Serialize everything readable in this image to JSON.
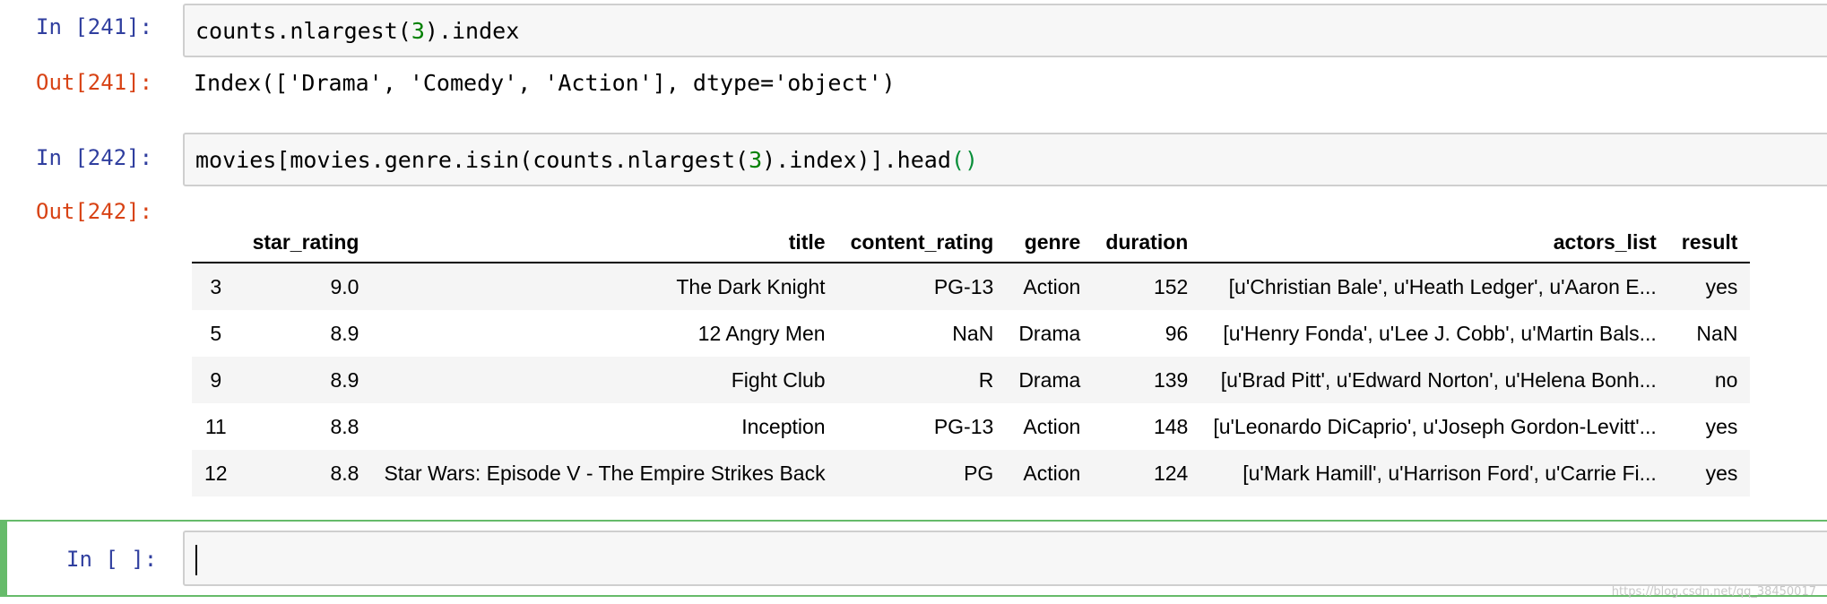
{
  "cells": [
    {
      "in_prompt": "In [241]:",
      "code": {
        "pre": "counts.nlargest(",
        "num": "3",
        "post": ").index"
      },
      "out_prompt": "Out[241]:",
      "output": "Index(['Drama', 'Comedy', 'Action'], dtype='object')"
    },
    {
      "in_prompt": "In [242]:",
      "code": {
        "pre": "movies[movies.genre.isin(counts.nlargest(",
        "num": "3",
        "mid": ").index)].head",
        "parens": "()"
      },
      "out_prompt": "Out[242]:",
      "table": {
        "columns": [
          "",
          "star_rating",
          "title",
          "content_rating",
          "genre",
          "duration",
          "actors_list",
          "result"
        ],
        "rows": [
          [
            "3",
            "9.0",
            "The Dark Knight",
            "PG-13",
            "Action",
            "152",
            "[u'Christian Bale', u'Heath Ledger', u'Aaron E...",
            "yes"
          ],
          [
            "5",
            "8.9",
            "12 Angry Men",
            "NaN",
            "Drama",
            "96",
            "[u'Henry Fonda', u'Lee J. Cobb', u'Martin Bals...",
            "NaN"
          ],
          [
            "9",
            "8.9",
            "Fight Club",
            "R",
            "Drama",
            "139",
            "[u'Brad Pitt', u'Edward Norton', u'Helena Bonh...",
            "no"
          ],
          [
            "11",
            "8.8",
            "Inception",
            "PG-13",
            "Action",
            "148",
            "[u'Leonardo DiCaprio', u'Joseph Gordon-Levitt'...",
            "yes"
          ],
          [
            "12",
            "8.8",
            "Star Wars: Episode V - The Empire Strikes Back",
            "PG",
            "Action",
            "124",
            "[u'Mark Hamill', u'Harrison Ford', u'Carrie Fi...",
            "yes"
          ]
        ]
      }
    },
    {
      "in_prompt": "In [ ]:",
      "code": ""
    }
  ],
  "watermark": "https://blog.csdn.net/qq_38450017",
  "colors": {
    "in_prompt": "#303F9F",
    "out_prompt": "#D84315",
    "active_border": "#66bb6a"
  }
}
